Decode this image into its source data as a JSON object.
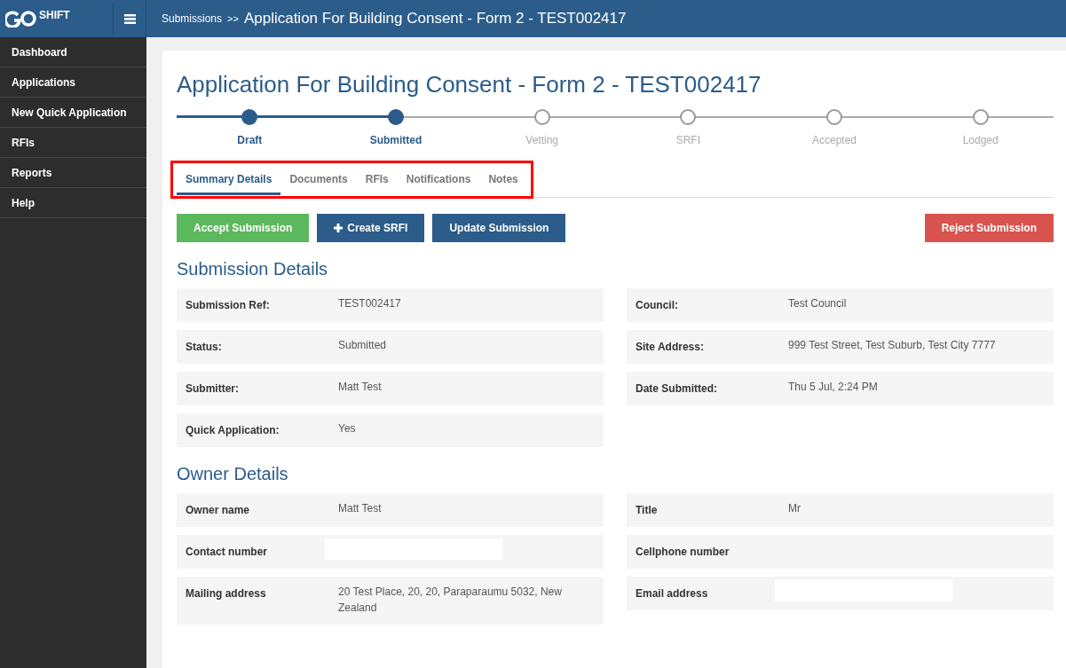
{
  "logo": {
    "text": "SHIFT"
  },
  "sidebar": {
    "items": [
      {
        "label": "Dashboard"
      },
      {
        "label": "Applications"
      },
      {
        "label": "New Quick Application"
      },
      {
        "label": "RFIs"
      },
      {
        "label": "Reports"
      },
      {
        "label": "Help"
      }
    ]
  },
  "breadcrumb": {
    "parent": "Submissions",
    "separator": ">>",
    "current": "Application For Building Consent - Form 2 - TEST002417"
  },
  "page_title": "Application For Building Consent - Form 2 - TEST002417",
  "steps": [
    {
      "label": "Draft",
      "completed": true
    },
    {
      "label": "Submitted",
      "completed": true
    },
    {
      "label": "Vetting",
      "completed": false
    },
    {
      "label": "SRFI",
      "completed": false
    },
    {
      "label": "Accepted",
      "completed": false
    },
    {
      "label": "Lodged",
      "completed": false
    }
  ],
  "tabs": {
    "highlighted": true,
    "items": [
      {
        "label": "Summary Details",
        "selected": true
      },
      {
        "label": "Documents",
        "selected": false
      },
      {
        "label": "RFIs",
        "selected": false
      },
      {
        "label": "Notifications",
        "selected": false
      },
      {
        "label": "Notes",
        "selected": false
      }
    ]
  },
  "actions": [
    {
      "label": "Accept Submission",
      "kind": "success"
    },
    {
      "label": "Create SRFI",
      "kind": "create"
    },
    {
      "label": "Update Submission",
      "kind": "primary"
    },
    {
      "label": "Reject Submission",
      "kind": "danger"
    }
  ],
  "sections": [
    {
      "title": "Submission Details",
      "rows": [
        {
          "left": {
            "label": "Submission Ref:",
            "value": "TEST002417"
          },
          "right": {
            "label": "Council:",
            "value": "Test Council"
          }
        },
        {
          "left": {
            "label": "Status:",
            "value": "Submitted"
          },
          "right": {
            "label": "Site Address:",
            "value": "999 Test Street, Test Suburb, Test City 7777"
          }
        },
        {
          "left": {
            "label": "Submitter:",
            "value": "Matt Test"
          },
          "right": {
            "label": "Date Submitted:",
            "value": "Thu 5 Jul, 2:24 PM"
          }
        },
        {
          "left": {
            "label": "Quick Application:",
            "value": "Yes"
          }
        }
      ]
    },
    {
      "title": "Owner Details",
      "rows": [
        {
          "left": {
            "label": "Owner name",
            "value": "Matt Test"
          },
          "right": {
            "label": "Title",
            "value": "Mr"
          }
        },
        {
          "left": {
            "label": "Contact number",
            "redacted": true
          },
          "right": {
            "label": "Cellphone number"
          }
        },
        {
          "left": {
            "label": "Mailing address",
            "value": "20 Test Place, 20, 20, Paraparaumu 5032, New Zealand"
          },
          "right": {
            "label": "Email address",
            "redacted": true
          }
        }
      ]
    }
  ]
}
